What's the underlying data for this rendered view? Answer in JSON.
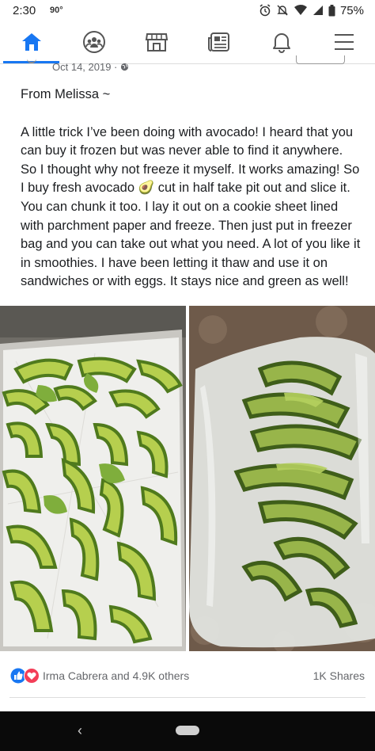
{
  "status_bar": {
    "time": "2:30",
    "temperature": "90°",
    "battery": "75%",
    "icons": [
      "alarm-icon",
      "mute-icon",
      "wifi-icon",
      "signal-icon",
      "battery-icon"
    ]
  },
  "nav": {
    "items": [
      {
        "name": "home",
        "icon": "home-icon",
        "active": true
      },
      {
        "name": "groups",
        "icon": "groups-icon",
        "active": false
      },
      {
        "name": "marketplace",
        "icon": "marketplace-icon",
        "active": false
      },
      {
        "name": "news",
        "icon": "news-icon",
        "active": false
      },
      {
        "name": "notifications",
        "icon": "bell-icon",
        "active": false
      },
      {
        "name": "menu",
        "icon": "menu-icon",
        "active": false
      }
    ],
    "accent_color": "#1877f2"
  },
  "post": {
    "date": "Oct 14, 2019 ·",
    "privacy_icon": "globe-icon",
    "greeting": "From Melissa ~",
    "body_part1": "A little trick I’ve been doing with avocado! I heard that you can buy it frozen but was never able to find it anywhere. So I thought why not freeze it myself. It works amazing! So I buy fresh avocado ",
    "emoji": "🥑",
    "body_part2": " cut in half take pit out and slice it. You can chunk it too. I lay it out on a cookie sheet lined with parchment paper and freeze. Then just put in freezer bag and you can take out what you need. A lot of you like it in smoothies. I have been letting it thaw and use it on sandwiches or with eggs. It stays nice and green as well!",
    "photos": [
      "avocado slices on parchment-lined cookie sheet",
      "frozen avocado slices in freezer bag"
    ]
  },
  "reactions": {
    "icons": [
      "like-icon",
      "love-icon"
    ],
    "summary": "Irma Cabrera and 4.9K others",
    "shares": "1K Shares"
  },
  "system_nav": {
    "icons": [
      "back-icon",
      "home-pill-icon"
    ]
  }
}
